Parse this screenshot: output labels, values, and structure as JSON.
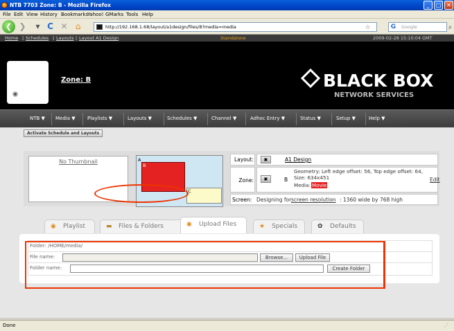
{
  "window": {
    "title": "NTB 7703 Zone: B - Mozilla Firefox"
  },
  "browser": {
    "menus": [
      "File",
      "Edit",
      "View",
      "History",
      "Bookmarks",
      "Yahoo!",
      "GMarks",
      "Tools",
      "Help"
    ],
    "url": "http://192.168.1.68/layout/a1design/files/8?media=media",
    "search_placeholder": "Google",
    "status": "Done"
  },
  "topstrip": {
    "breadcrumb": [
      "Home",
      "Schedules",
      "Layouts",
      "Layout A1 Design"
    ],
    "mode": "Standalone",
    "datetime": "2009-02-28 15:10:04 GMT"
  },
  "header": {
    "zone_title": "Zone: B",
    "brand": "BLACK BOX",
    "brand_sub": "NETWORK SERVICES"
  },
  "navmenu": [
    "NTB ▼",
    "Media ▼",
    "Playlists ▼",
    "Layouts ▼",
    "Schedules ▼",
    "Channel ▼",
    "Adhoc Entry ▼",
    "Status ▼",
    "Setup ▼",
    "Help ▼"
  ],
  "activate_label": "Activate Schedule and Layouts",
  "info": {
    "no_thumbnail": "No Thumbnail",
    "zones": {
      "a": "A",
      "b": "B",
      "c": "C"
    },
    "layout_label": "Layout:",
    "layout_value": "A1 Design",
    "zone_label": "Zone:",
    "zone_letter": "B",
    "zone_geometry": "Geometry: Left edge offset: 56, Top edge offset: 64, Size: 634x451",
    "zone_media_label": "Media:",
    "zone_media_value": "Movie",
    "edit_label": "Edit",
    "screen_label": "Screen:",
    "screen_prefix": "Designing for",
    "screen_link": "screen resolution",
    "screen_suffix": ": 1360 wide by 768 high"
  },
  "tabs": [
    {
      "label": "Playlist",
      "icon": "playlist-icon"
    },
    {
      "label": "Files & Folders",
      "icon": "folder-icon"
    },
    {
      "label": "Upload Files",
      "icon": "upload-icon"
    },
    {
      "label": "Specials",
      "icon": "star-icon"
    },
    {
      "label": "Defaults",
      "icon": "gear-icon"
    }
  ],
  "upload": {
    "folder_text": "Folder: /HOME/media/",
    "file_name_label": "File name:",
    "browse_label": "Browse...",
    "upload_label": "Upload File",
    "folder_name_label": "Folder name:",
    "create_folder_label": "Create Folder"
  },
  "colors": {
    "annotation_red": "#e33300",
    "zone_b": "#e52222",
    "zone_c": "#fdfac9",
    "preview_bg": "#cfe6f3"
  }
}
